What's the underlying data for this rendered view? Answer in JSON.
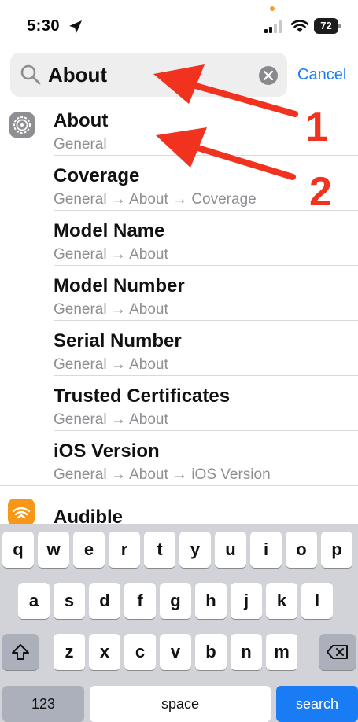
{
  "status_bar": {
    "time": "5:30",
    "battery": "72",
    "icons": [
      "location-arrow-icon",
      "signal-icon",
      "wifi-icon",
      "battery-icon"
    ]
  },
  "search": {
    "value": "About",
    "cancel_label": "Cancel"
  },
  "results": [
    {
      "title": "About",
      "path": "General"
    },
    {
      "title": "Coverage",
      "path": "General → About → Coverage"
    },
    {
      "title": "Model Name",
      "path": "General → About"
    },
    {
      "title": "Model Number",
      "path": "General → About"
    },
    {
      "title": "Serial Number",
      "path": "General → About"
    },
    {
      "title": "Trusted Certificates",
      "path": "General → About"
    },
    {
      "title": "iOS Version",
      "path": "General → About → iOS Version"
    }
  ],
  "next_section": {
    "title": "Audible"
  },
  "annotations": [
    "1",
    "2"
  ],
  "keyboard": {
    "row1": [
      "q",
      "w",
      "e",
      "r",
      "t",
      "y",
      "u",
      "i",
      "o",
      "p"
    ],
    "row2": [
      "a",
      "s",
      "d",
      "f",
      "g",
      "h",
      "j",
      "k",
      "l"
    ],
    "row3": [
      "z",
      "x",
      "c",
      "v",
      "b",
      "n",
      "m"
    ],
    "numbers_label": "123",
    "space_label": "space",
    "search_label": "search"
  },
  "colors": {
    "accent": "#1a7cf5",
    "annotation": "#f0321e",
    "audible": "#f79617"
  }
}
